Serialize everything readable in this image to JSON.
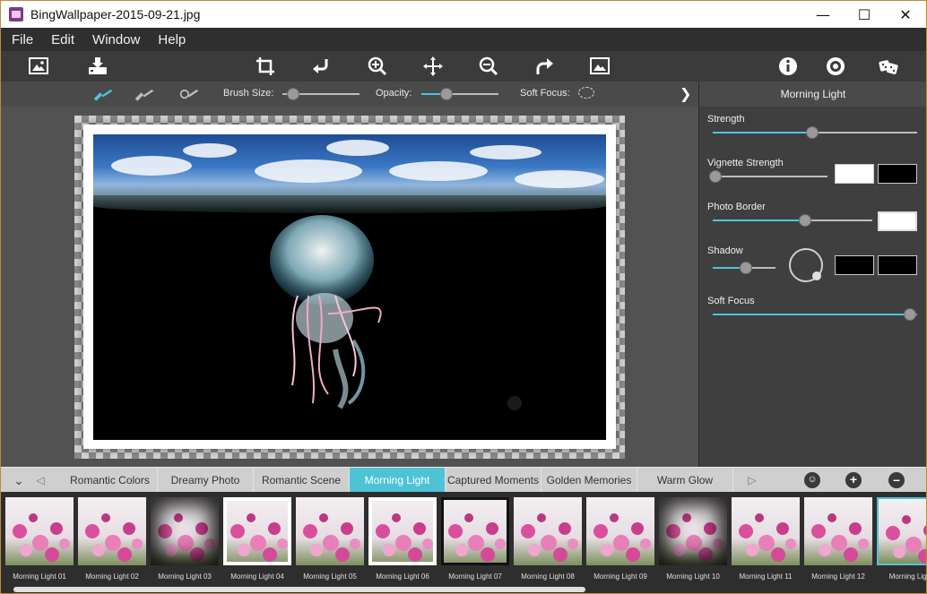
{
  "window": {
    "title": "BingWallpaper-2015-09-21.jpg"
  },
  "menu": [
    "File",
    "Edit",
    "Window",
    "Help"
  ],
  "toolbar": {
    "left": [
      "open-image-icon",
      "save-icon"
    ],
    "center": [
      "crop-icon",
      "rotate-left-icon",
      "zoom-in-icon",
      "move-icon",
      "zoom-out-icon",
      "rotate-right-icon",
      "fit-image-icon"
    ],
    "right": [
      "info-icon",
      "settings-icon",
      "random-dice-icon"
    ]
  },
  "brushbar": {
    "brush_size_label": "Brush Size:",
    "brush_size_value": 0.1,
    "opacity_label": "Opacity:",
    "opacity_value": 0.3,
    "soft_focus_label": "Soft Focus:"
  },
  "panel": {
    "title": "Morning Light",
    "strength": {
      "label": "Strength",
      "value": 0.5
    },
    "vignette": {
      "label": "Vignette Strength",
      "value": 0.0,
      "color1": "#ffffff",
      "color2": "#000000"
    },
    "border": {
      "label": "Photo Border",
      "value": 0.58,
      "color": "#ffffff"
    },
    "shadow": {
      "label": "Shadow",
      "value": 0.55,
      "color1": "#000000",
      "color2": "#000000"
    },
    "soft_focus": {
      "label": "Soft Focus",
      "value": 1.0
    }
  },
  "tabs": [
    {
      "label": "Romantic Colors",
      "active": false
    },
    {
      "label": "Dreamy Photo",
      "active": false
    },
    {
      "label": "Romantic Scene",
      "active": false
    },
    {
      "label": "Morning Light",
      "active": true
    },
    {
      "label": "Captured Moments",
      "active": false
    },
    {
      "label": "Golden Memories",
      "active": false
    },
    {
      "label": "Warm Glow",
      "active": false
    }
  ],
  "thumbnails": [
    {
      "label": "Morning Light 01",
      "style": "plain"
    },
    {
      "label": "Morning Light 02",
      "style": "plain"
    },
    {
      "label": "Morning Light 03",
      "style": "vignette"
    },
    {
      "label": "Morning Light 04",
      "style": "border"
    },
    {
      "label": "Morning Light 05",
      "style": "plain"
    },
    {
      "label": "Morning Light 06",
      "style": "border"
    },
    {
      "label": "Morning Light 07",
      "style": "black-border"
    },
    {
      "label": "Morning Light 08",
      "style": "plain"
    },
    {
      "label": "Morning Light 09",
      "style": "plain"
    },
    {
      "label": "Morning Light 10",
      "style": "vignette"
    },
    {
      "label": "Morning Light 11",
      "style": "plain"
    },
    {
      "label": "Morning Light 12",
      "style": "plain"
    },
    {
      "label": "Morning Light",
      "style": "selected"
    }
  ],
  "colors": {
    "accent": "#4ec3d6",
    "dark": "#3a3a3a"
  }
}
